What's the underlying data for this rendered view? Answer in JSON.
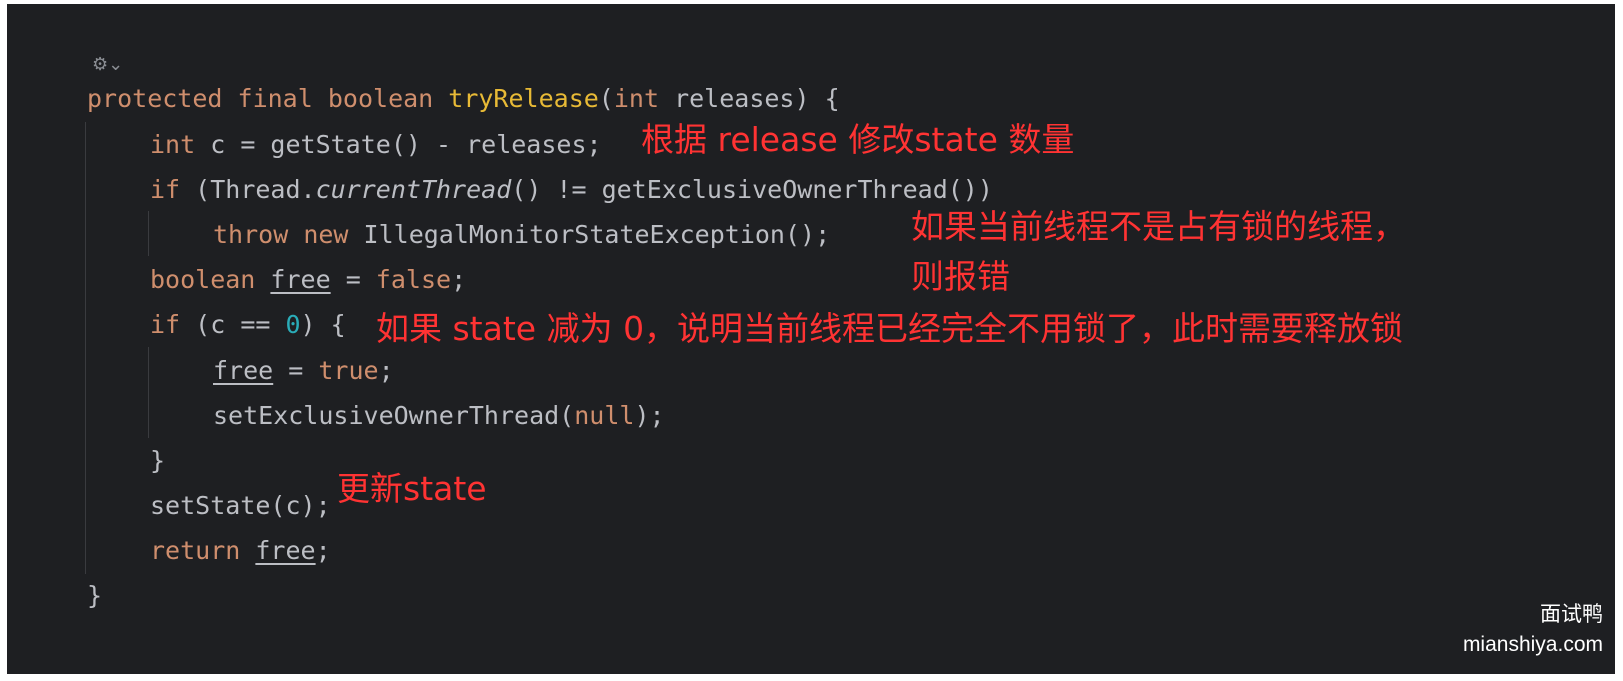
{
  "editor": {
    "marker": "⚙⌄",
    "code": {
      "l1": [
        "protected",
        "final",
        "boolean",
        "tryRelease",
        "(",
        "int",
        "releases",
        ") {"
      ],
      "l2": [
        "int",
        "c = getState() - releases;"
      ],
      "l3": [
        "if",
        "(Thread.",
        "currentThread",
        "() != getExclusiveOwnerThread())"
      ],
      "l4": [
        "throw",
        "new",
        "IllegalMonitorStateException();"
      ],
      "l5": [
        "boolean",
        "free",
        " = ",
        "false",
        ";"
      ],
      "l6": [
        "if",
        "(c == ",
        "0",
        ") {"
      ],
      "l7": [
        "free",
        " = ",
        "true",
        ";"
      ],
      "l8": [
        "setExclusiveOwnerThread(",
        "null",
        ");"
      ],
      "l9": [
        "}"
      ],
      "l10": [
        "setState(c);"
      ],
      "l11": [
        "return",
        "free",
        ";"
      ],
      "l12": [
        "}"
      ]
    }
  },
  "annotations": {
    "a1": "根据 release 修改state 数量",
    "a2_1": "如果当前线程不是占有锁的线程，",
    "a2_2": "则报错",
    "a3": "如果 state 减为 0，说明当前线程已经完全不用锁了，此时需要释放锁",
    "a4": "更新state"
  },
  "watermark": {
    "cn": "面试鸭",
    "url": "mianshiya.com"
  }
}
